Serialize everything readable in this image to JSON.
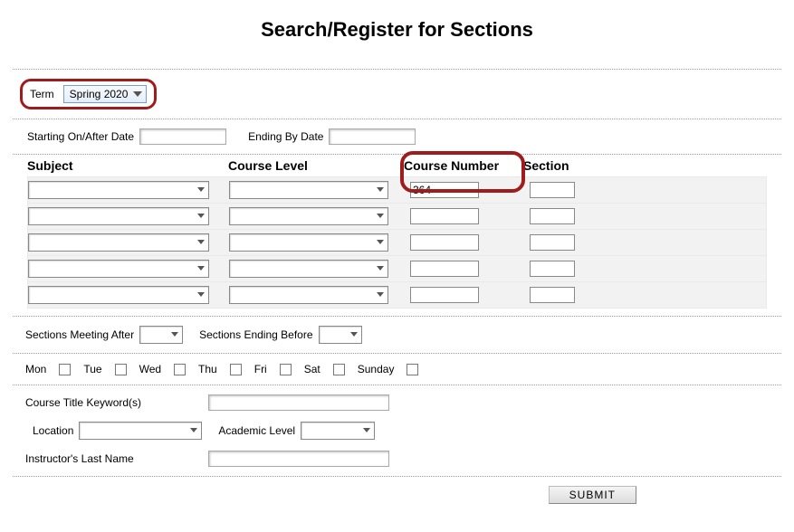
{
  "title": "Search/Register for Sections",
  "term": {
    "label": "Term",
    "value": "Spring 2020"
  },
  "dates": {
    "start_label": "Starting On/After Date",
    "end_label": "Ending By Date",
    "start": "",
    "end": ""
  },
  "grid": {
    "headers": {
      "subject": "Subject",
      "level": "Course Level",
      "course_number": "Course Number",
      "section": "Section"
    },
    "rows": [
      {
        "subject": "",
        "level": "",
        "course_number": "364",
        "section": ""
      },
      {
        "subject": "",
        "level": "",
        "course_number": "",
        "section": ""
      },
      {
        "subject": "",
        "level": "",
        "course_number": "",
        "section": ""
      },
      {
        "subject": "",
        "level": "",
        "course_number": "",
        "section": ""
      },
      {
        "subject": "",
        "level": "",
        "course_number": "",
        "section": ""
      }
    ]
  },
  "meeting": {
    "after_label": "Sections Meeting After",
    "before_label": "Sections Ending Before",
    "after": "",
    "before": ""
  },
  "days": {
    "mon": "Mon",
    "tue": "Tue",
    "wed": "Wed",
    "thu": "Thu",
    "fri": "Fri",
    "sat": "Sat",
    "sun": "Sunday"
  },
  "keywords": {
    "label": "Course Title Keyword(s)",
    "value": ""
  },
  "location": {
    "label": "Location",
    "value": ""
  },
  "academic_level": {
    "label": "Academic Level",
    "value": ""
  },
  "instructor": {
    "label": "Instructor's Last Name",
    "value": ""
  },
  "submit_label": "SUBMIT"
}
